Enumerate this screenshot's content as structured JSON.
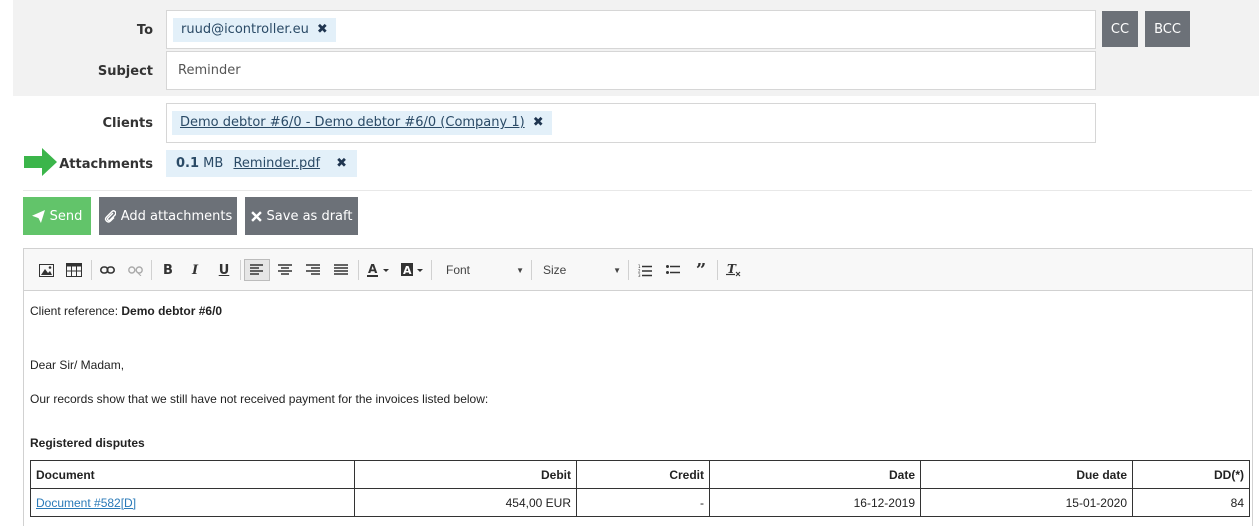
{
  "form": {
    "to_label": "To",
    "to_recipient": "ruud@icontroller.eu",
    "cc_label": "CC",
    "bcc_label": "BCC",
    "subject_label": "Subject",
    "subject_value": "Reminder",
    "clients_label": "Clients",
    "client_tag": "Demo debtor #6/0 - Demo debtor #6/0 (Company 1)",
    "attachments_label": "Attachments",
    "attachment_size_value": "0.1",
    "attachment_size_unit": "MB",
    "attachment_name": "Reminder.pdf",
    "remove_glyph": "✖"
  },
  "actions": {
    "send_label": "Send",
    "add_attachments_label": "Add attachments",
    "save_draft_label": "Save as draft"
  },
  "toolbar": {
    "font_label": "Font",
    "size_label": "Size",
    "bold": "B",
    "italic": "I",
    "underline": "U"
  },
  "body": {
    "client_ref_prefix": "Client reference: ",
    "client_ref_value": "Demo debtor #6/0",
    "greeting": "Dear Sir/ Madam,",
    "intro": "Our records show that we still have not received payment for the invoices listed below:",
    "section_heading": "Registered disputes"
  },
  "table": {
    "headers": [
      "Document",
      "Debit",
      "Credit",
      "Date",
      "Due date",
      "DD(*)"
    ],
    "rows": [
      [
        "Document #582[D]",
        "454,00 EUR",
        "-",
        "16-12-2019",
        "15-01-2020",
        "84"
      ]
    ]
  },
  "colors": {
    "accent_green": "#62c46a",
    "button_grey": "#6c7178",
    "tag_bg": "#e3f0f9",
    "arrow_green": "#3bb54a"
  }
}
